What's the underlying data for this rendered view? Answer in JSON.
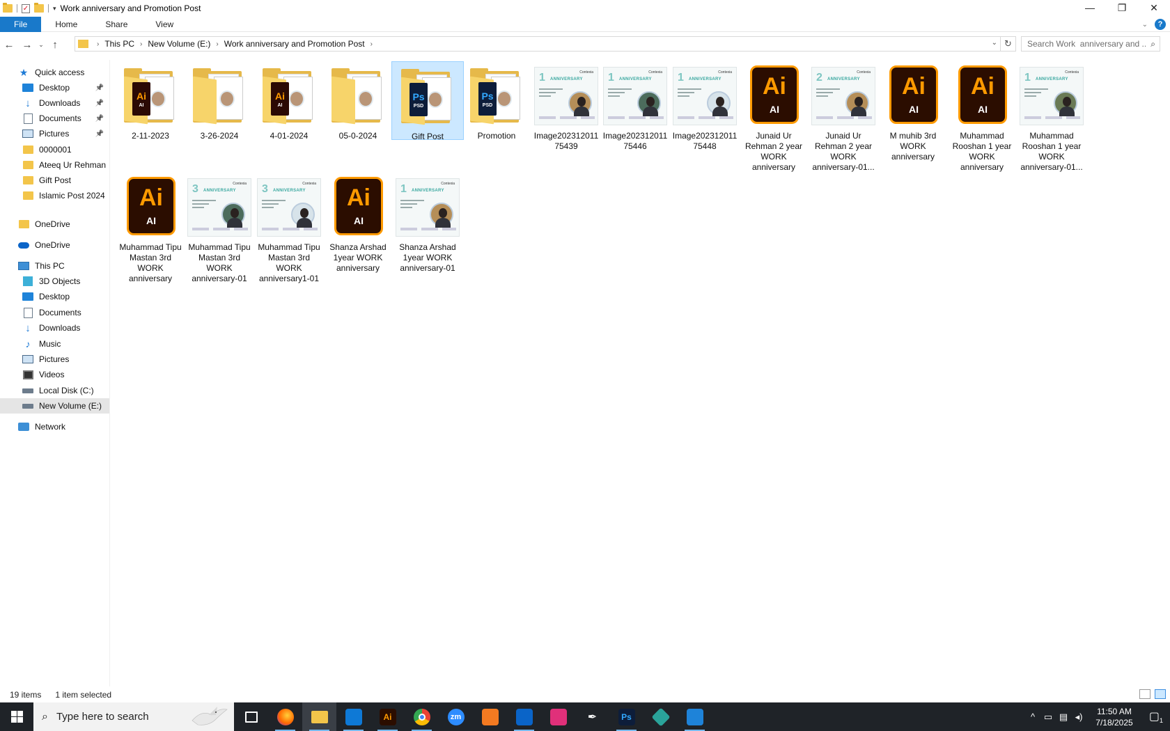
{
  "window": {
    "title": "Work  anniversary and Promotion  Post",
    "minimize": "—",
    "maximize": "❐",
    "close": "✕"
  },
  "ribbon": {
    "tabs": [
      "File",
      "Home",
      "Share",
      "View"
    ],
    "help": "?",
    "expand": "⌄"
  },
  "address": {
    "crumbs": [
      "This PC",
      "New Volume (E:)",
      "Work  anniversary and Promotion  Post"
    ],
    "search_placeholder": "Search Work  anniversary and ..."
  },
  "sidebar": {
    "quick_access": "Quick access",
    "quick_items": [
      {
        "label": "Desktop",
        "icon": "desktop-icon",
        "pinned": true
      },
      {
        "label": "Downloads",
        "icon": "downloads-icon",
        "pinned": true
      },
      {
        "label": "Documents",
        "icon": "documents-icon",
        "pinned": true
      },
      {
        "label": "Pictures",
        "icon": "pictures-icon",
        "pinned": true
      },
      {
        "label": "0000001",
        "icon": "folder-icon",
        "pinned": false
      },
      {
        "label": "Ateeq Ur Rehman",
        "icon": "folder-icon",
        "pinned": false
      },
      {
        "label": "Gift Post",
        "icon": "folder-icon",
        "pinned": false
      },
      {
        "label": "Islamic Post 2024",
        "icon": "folder-icon",
        "pinned": false
      }
    ],
    "onedrive_personal": "OneDrive",
    "onedrive": "OneDrive",
    "this_pc": "This PC",
    "pc_items": [
      {
        "label": "3D Objects",
        "icon": "3d-objects-icon"
      },
      {
        "label": "Desktop",
        "icon": "desktop-icon"
      },
      {
        "label": "Documents",
        "icon": "documents-icon"
      },
      {
        "label": "Downloads",
        "icon": "downloads-icon"
      },
      {
        "label": "Music",
        "icon": "music-icon"
      },
      {
        "label": "Pictures",
        "icon": "pictures-icon"
      },
      {
        "label": "Videos",
        "icon": "videos-icon"
      },
      {
        "label": "Local Disk (C:)",
        "icon": "local-disk-icon"
      },
      {
        "label": "New Volume (E:)",
        "icon": "drive-icon",
        "selected": true
      }
    ],
    "network": "Network"
  },
  "files": [
    {
      "name": "2-11-2023",
      "kind": "folder-ai"
    },
    {
      "name": "3-26-2024",
      "kind": "folder-photo"
    },
    {
      "name": "4-01-2024",
      "kind": "folder-ai"
    },
    {
      "name": "05-0-2024",
      "kind": "folder-photo"
    },
    {
      "name": "Gift Post",
      "kind": "folder-ps",
      "selected": true
    },
    {
      "name": "Promotion",
      "kind": "folder-ps"
    },
    {
      "name": "Image20231201175439",
      "display": "Image202312011\n75439",
      "kind": "post",
      "num": "1",
      "ord": "st"
    },
    {
      "name": "Image20231201175446",
      "display": "Image202312011\n75446",
      "kind": "post",
      "num": "1",
      "ord": "st"
    },
    {
      "name": "Image20231201175448",
      "display": "Image202312011\n75448",
      "kind": "post",
      "num": "1",
      "ord": "st"
    },
    {
      "name": "Junaid Ur Rehman 2  year WORK anniversary",
      "display": "Junaid Ur\nRehman 2  year\nWORK\nanniversary",
      "kind": "ai"
    },
    {
      "name": "Junaid Ur Rehman 2  year WORK anniversary-01",
      "display": "Junaid Ur\nRehman 2  year\nWORK\nanniversary-01...",
      "kind": "post",
      "num": "2",
      "ord": "nd"
    },
    {
      "name": "M muhib 3rd WORK anniversary",
      "display": "M muhib 3rd\nWORK\nanniversary",
      "kind": "ai"
    },
    {
      "name": "Muhammad Rooshan 1 year WORK anniversary",
      "display": "Muhammad\nRooshan 1 year\nWORK\nanniversary",
      "kind": "ai"
    },
    {
      "name": "Muhammad Rooshan 1 year WORK anniversary-01",
      "display": "Muhammad\nRooshan 1 year\nWORK\nanniversary-01...",
      "kind": "post",
      "num": "1",
      "ord": "st"
    },
    {
      "name": "Muhammad Tipu Mastan 3rd WORK anniversary",
      "display": "Muhammad Tipu\nMastan 3rd\nWORK\nanniversary",
      "kind": "ai"
    },
    {
      "name": "Muhammad Tipu Mastan 3rd WORK anniversary-01",
      "display": "Muhammad Tipu\nMastan 3rd\nWORK\nanniversary-01",
      "kind": "post",
      "num": "3",
      "ord": "rd"
    },
    {
      "name": "Muhammad Tipu Mastan 3rd WORK anniversary1-01",
      "display": "Muhammad Tipu\nMastan 3rd\nWORK\nanniversary1-01",
      "kind": "post",
      "num": "3",
      "ord": "rd"
    },
    {
      "name": "Shanza Arshad 1year WORK anniversary",
      "display": "Shanza Arshad\n1year WORK\nanniversary",
      "kind": "ai"
    },
    {
      "name": "Shanza Arshad 1year WORK anniversary-01",
      "display": "Shanza Arshad\n1year WORK\nanniversary-01",
      "kind": "post",
      "num": "1",
      "ord": "st"
    }
  ],
  "thumb_text": {
    "ai_big": "Ai",
    "ai_small": "AI",
    "ps_big": "Ps",
    "ps_small": "PSD",
    "anniversary": "ANNIVERSARY",
    "brand": "Contexia"
  },
  "status": {
    "count": "19 items",
    "selection": "1 item selected"
  },
  "taskbar": {
    "search_placeholder": "Type here to search",
    "apps": [
      {
        "name": "task-view",
        "label": ""
      },
      {
        "name": "firefox",
        "label": "",
        "color": "#e66000"
      },
      {
        "name": "file-explorer",
        "label": "",
        "color": "#f3c54a"
      },
      {
        "name": "vscode",
        "label": "",
        "color": "#0e79d6"
      },
      {
        "name": "illustrator",
        "label": "Ai",
        "color": "#2b0d00"
      },
      {
        "name": "chrome",
        "label": "",
        "color": "#34a853"
      },
      {
        "name": "zoom",
        "label": "zm",
        "color": "#2d8cff"
      },
      {
        "name": "xampp",
        "label": "",
        "color": "#f37a21"
      },
      {
        "name": "outlook",
        "label": "",
        "color": "#0a64c8"
      },
      {
        "name": "creative-cloud",
        "label": "",
        "color": "#e0307a"
      },
      {
        "name": "pen-tool",
        "label": "",
        "color": "#1f2328"
      },
      {
        "name": "photoshop",
        "label": "Ps",
        "color": "#0d1d3a"
      },
      {
        "name": "app-diamond",
        "label": "",
        "color": "#2aa39a"
      },
      {
        "name": "photos",
        "label": "",
        "color": "#1e83d9"
      }
    ],
    "time": "11:50 AM",
    "date": "7/18/2025",
    "notif_count": "1"
  },
  "colors": {
    "accent": "#1979ca",
    "selection_bg": "#cce8ff",
    "taskbar_bg": "#1f2328"
  }
}
